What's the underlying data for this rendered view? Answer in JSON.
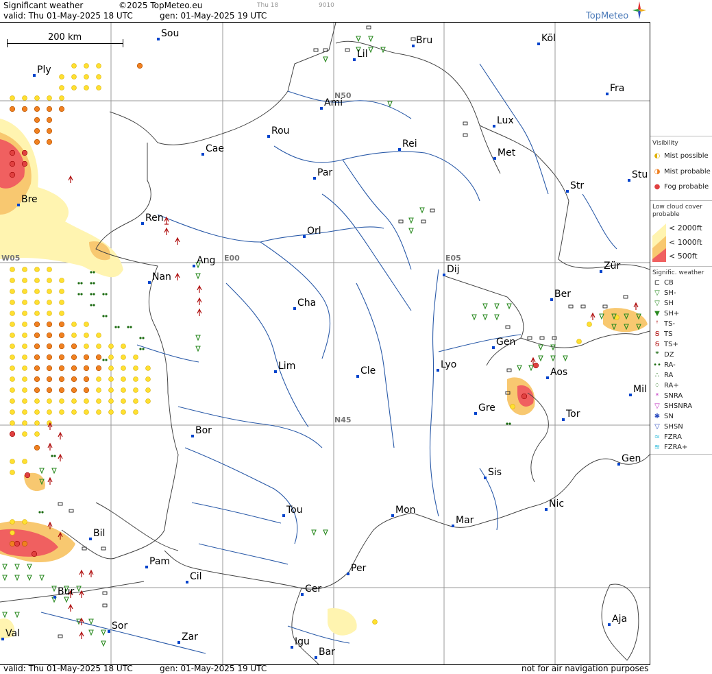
{
  "header": {
    "title": "Significant weather",
    "copyright": "©2025 TopMeteo.eu",
    "extra1": "Thu 18",
    "extra2": "9010",
    "valid": "valid:  Thu  01-May-2025  18 UTC",
    "gen": "gen:  01-May-2025 19 UTC",
    "logo": "TopMeteo"
  },
  "scale": {
    "label": "200 km"
  },
  "grid": {
    "n50": "N50",
    "n45": "N45",
    "w05": "W05",
    "e00": "E00",
    "e05": "E05"
  },
  "cities": {
    "sou": "Sou",
    "ply": "Ply",
    "lil": "Lil",
    "bru": "Bru",
    "kol": "Köl",
    "fra": "Fra",
    "ami": "Ami",
    "rou": "Rou",
    "cae": "Cae",
    "lux": "Lux",
    "rei": "Rei",
    "met": "Met",
    "par": "Par",
    "str": "Str",
    "stu": "Stu",
    "bre": "Bre",
    "ren": "Ren",
    "orl": "Orl",
    "ang": "Ang",
    "nan": "Nan",
    "dij": "Dij",
    "zur": "Zür",
    "ber": "Ber",
    "cha": "Cha",
    "gen1": "Gen",
    "lim": "Lim",
    "cle": "Cle",
    "lyo": "Lyo",
    "aos": "Aos",
    "mil": "Mil",
    "gre": "Gre",
    "tor": "Tor",
    "bor": "Bor",
    "gen2": "Gen",
    "sis": "Sis",
    "nic": "Nic",
    "tou": "Tou",
    "mon": "Mon",
    "mar": "Mar",
    "bil": "Bil",
    "pam": "Pam",
    "per": "Per",
    "cil": "Cil",
    "cer": "Cer",
    "bur": "Bur",
    "sor": "Sor",
    "aja": "Aja",
    "val": "Val",
    "zar": "Zar",
    "igu": "Igu",
    "bar": "Bar"
  },
  "footer": {
    "valid": "valid:  Thu  01-May-2025  18 UTC",
    "gen": "gen:  01-May-2025 19 UTC",
    "note": "not for air navigation purposes"
  },
  "legend": {
    "visibility_title": "Visibility",
    "mist_possible": "Mist possible",
    "mist_probable": "Mist probable",
    "fog_probable": "Fog probable",
    "low_cloud_title": "Low cloud cover probable",
    "lc_2000": "< 2000ft",
    "lc_1000": "< 1000ft",
    "lc_500": "<  500ft",
    "signif_title": "Signific. weather",
    "items": [
      "CB",
      "SH-",
      "SH",
      "SH+",
      "TS-",
      "TS",
      "TS+",
      "DZ",
      "RA-",
      "RA",
      "RA+",
      "SNRA",
      "SHSNRA",
      "SN",
      "SHSN",
      "FZRA",
      "FZRA+"
    ]
  },
  "colors": {
    "mist_possible": "#ffe030",
    "mist_probable": "#f08020",
    "fog_probable": "#e04040",
    "lowcloud_2000": "#fff4b0",
    "lowcloud_1000": "#f8c870",
    "lowcloud_500": "#f06060",
    "rivers": "#2a5aa8",
    "borders": "#444444",
    "grid": "#999999"
  }
}
